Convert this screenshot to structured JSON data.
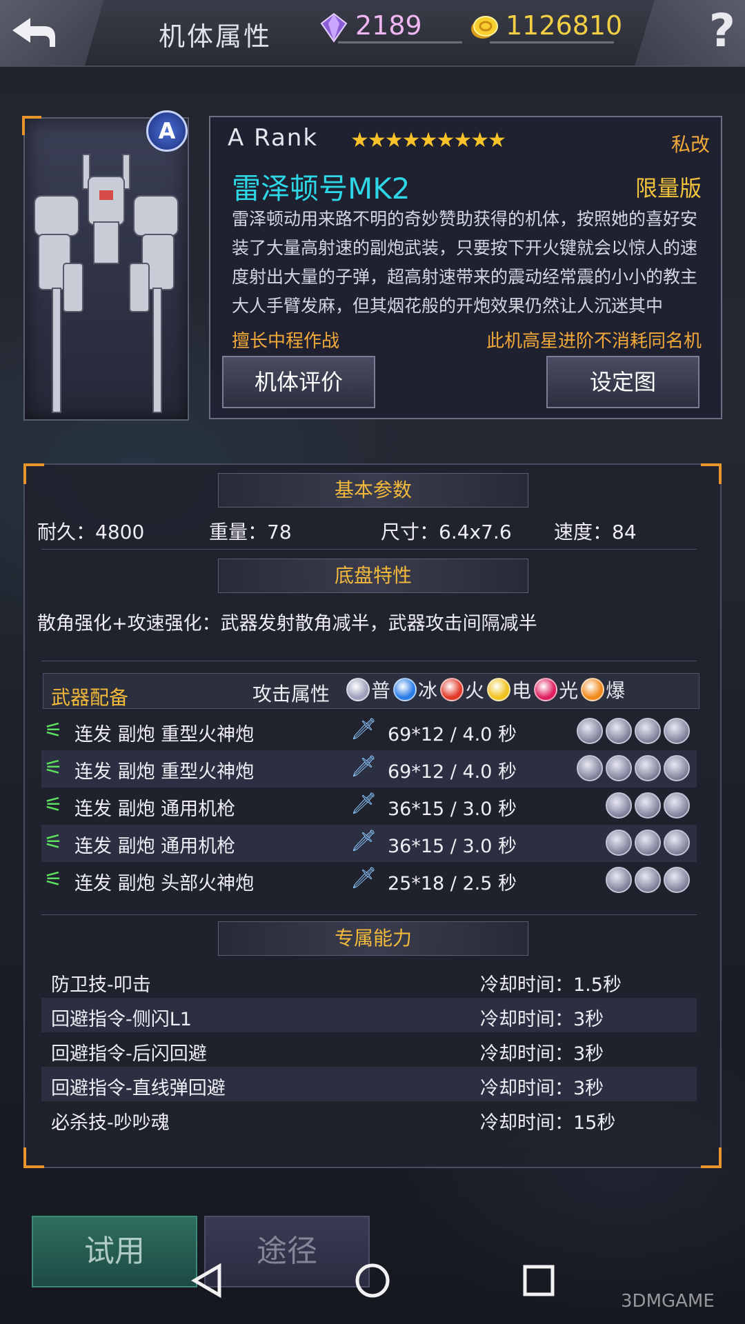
{
  "topbar": {
    "title": "机体属性",
    "gems": "2189",
    "coins": "1126810",
    "help": "?"
  },
  "mech": {
    "rank_badge": "A",
    "rank": "A  Rank",
    "stars": "★★★★★★★★★",
    "star_count": 9,
    "mod_tag": "私改",
    "name": "雷泽顿号MK2",
    "limited": "限量版",
    "description": "雷泽顿动用来路不明的奇妙赞助获得的机体，按照她的喜好安装了大量高射速的副炮武装，只要按下开火键就会以惊人的速度射出大量的子弹，超高射速带来的震动经常震的小小的教主大人手臂发麻，但其烟花般的开炮效果仍然让人沉迷其中",
    "skill": "擅长中程作战",
    "note": "此机高星进阶不消耗同名机",
    "eval_button": "机体评价",
    "setting_button": "设定图"
  },
  "basic": {
    "header": "基本参数",
    "durability": "耐久：4800",
    "weight": "重量：78",
    "size": "尺寸：6.4x7.6",
    "speed": "速度：84"
  },
  "chassis": {
    "header": "底盘特性",
    "text": "散角强化+攻速强化：武器发射散角减半，武器攻击间隔减半"
  },
  "weapons": {
    "header": "武器配备",
    "attr_label": "攻击属性",
    "elements": [
      {
        "label": "普",
        "color": "#9fa1bc"
      },
      {
        "label": "冰",
        "color": "#2a7de8"
      },
      {
        "label": "火",
        "color": "#e23a2a"
      },
      {
        "label": "电",
        "color": "#f0c21e"
      },
      {
        "label": "光",
        "color": "#e0205e"
      },
      {
        "label": "爆",
        "color": "#f08a1c"
      }
    ],
    "rows": [
      {
        "name": "连发 副炮  重型火神炮",
        "dmg": "69*12 / 4.0 秒",
        "slots": 4
      },
      {
        "name": "连发 副炮  重型火神炮",
        "dmg": "69*12 / 4.0 秒",
        "slots": 4
      },
      {
        "name": "连发 副炮  通用机枪",
        "dmg": "36*15 / 3.0 秒",
        "slots": 3
      },
      {
        "name": "连发 副炮  通用机枪",
        "dmg": "36*15 / 3.0 秒",
        "slots": 3
      },
      {
        "name": "连发 副炮  头部火神炮",
        "dmg": "25*18 / 2.5 秒",
        "slots": 3
      }
    ]
  },
  "abilities": {
    "header": "专属能力",
    "rows": [
      {
        "name": "防卫技-叩击",
        "cd": "冷却时间：1.5秒"
      },
      {
        "name": "回避指令-侧闪L1",
        "cd": "冷却时间：3秒"
      },
      {
        "name": "回避指令-后闪回避",
        "cd": "冷却时间：3秒"
      },
      {
        "name": "回避指令-直线弹回避",
        "cd": "冷却时间：3秒"
      },
      {
        "name": "必杀技-吵吵魂",
        "cd": "冷却时间：15秒"
      }
    ]
  },
  "bottom": {
    "trial": "试用",
    "path": "途径"
  },
  "watermark": "3DMGAME"
}
